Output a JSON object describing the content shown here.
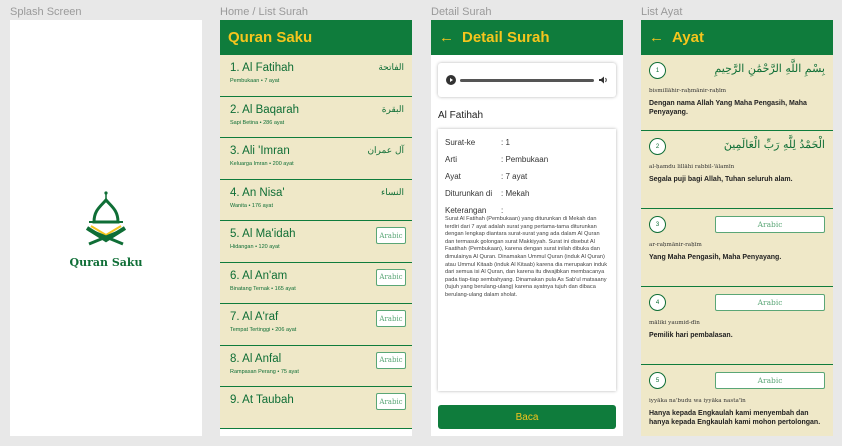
{
  "frames": {
    "splash": "Splash Screen",
    "home": "Home / List Surah",
    "detail": "Detail Surah",
    "ayat": "List Ayat"
  },
  "splash": {
    "app_name": "Quran Saku"
  },
  "home": {
    "title": "Quran Saku",
    "surahs": [
      {
        "title": "1. Al Fatihah",
        "sub": "Pembukaan • 7 ayat",
        "arabic": "الفاتحة"
      },
      {
        "title": "2. Al Baqarah",
        "sub": "Sapi Betina • 286 ayat",
        "arabic": "البقرة"
      },
      {
        "title": "3. Ali 'Imran",
        "sub": "Keluarga Imran • 200 ayat",
        "arabic": "آل عمران"
      },
      {
        "title": "4. An Nisa'",
        "sub": "Wanita • 176 ayat",
        "arabic": "النساء"
      },
      {
        "title": "5. Al Ma'idah",
        "sub": "Hidangan • 120 ayat",
        "arabic": "Arabic"
      },
      {
        "title": "6. Al An'am",
        "sub": "Binatang Ternak • 165 ayat",
        "arabic": "Arabic"
      },
      {
        "title": "7. Al A'raf",
        "sub": "Tempat Tertinggi • 206 ayat",
        "arabic": "Arabic"
      },
      {
        "title": "8. Al Anfal",
        "sub": "Rampasan Perang • 75 ayat",
        "arabic": "Arabic"
      },
      {
        "title": "9. At Taubah",
        "sub": "",
        "arabic": "Arabic"
      }
    ]
  },
  "detail": {
    "title": "Detail Surah",
    "surah_name": "Al Fatihah",
    "rows": [
      {
        "k": "Surat-ke",
        "v": ": 1"
      },
      {
        "k": "Arti",
        "v": ": Pembukaan"
      },
      {
        "k": "Ayat",
        "v": ": 7 ayat"
      },
      {
        "k": "Diturunkan di",
        "v": ": Mekah"
      },
      {
        "k": "Keterangan",
        "v": ":"
      }
    ],
    "description": "Surat Al Fatihah (Pembukaan) yang diturunkan di Mekah dan terdiri dari 7 ayat adalah surat yang pertama-tama diturunkan dengan lengkap diantara surat-surat yang ada dalam Al Quran dan termasuk golongan surat Makkiyyah. Surat ini disebut Al Faatihah (Pembukaan), karena dengan surat inilah dibuka dan dimulainya Al Quran. Dinamakan Ummul Quran (induk Al Quran) atau Ummul Kitaab (induk Al Kitaab) karena dia merupakan induk dari semua isi Al Quran, dan karena itu diwajibkan membacanya pada tiap-tiap sembahyang. Dinamakan pula As Sab'ul matsaany (tujuh yang berulang-ulang) karena ayatnya tujuh dan dibaca berulang-ulang dalam sholat.",
    "button": "Baca"
  },
  "ayat": {
    "title": "Ayat",
    "items": [
      {
        "num": "1",
        "arabic": "بِسْمِ اللَّهِ الرَّحْمَٰنِ الرَّحِيمِ",
        "latin": "bismillāhir-raḥmānir-raḥīm",
        "trans": "Dengan nama Allah Yang Maha Pengasih, Maha Penyayang."
      },
      {
        "num": "2",
        "arabic": "الْحَمْدُ لِلَّهِ رَبِّ الْعَالَمِينَ",
        "latin": "al-ḥamdu lillāhi rabbil-'ālamīn",
        "trans": "Segala puji bagi Allah, Tuhan seluruh alam."
      },
      {
        "num": "3",
        "arabic": "Arabic",
        "latin": "ar-raḥmānir-raḥīm",
        "trans": "Yang Maha Pengasih, Maha Penyayang."
      },
      {
        "num": "4",
        "arabic": "Arabic",
        "latin": "māliki yaumid-dīn",
        "trans": "Pemilik hari pembalasan."
      },
      {
        "num": "5",
        "arabic": "Arabic",
        "latin": "iyyāka na'budu wa iyyāka nasta'īn",
        "trans": "Hanya kepada Engkaulah kami menyembah dan hanya kepada Engkaulah kami mohon pertolongan."
      }
    ]
  }
}
